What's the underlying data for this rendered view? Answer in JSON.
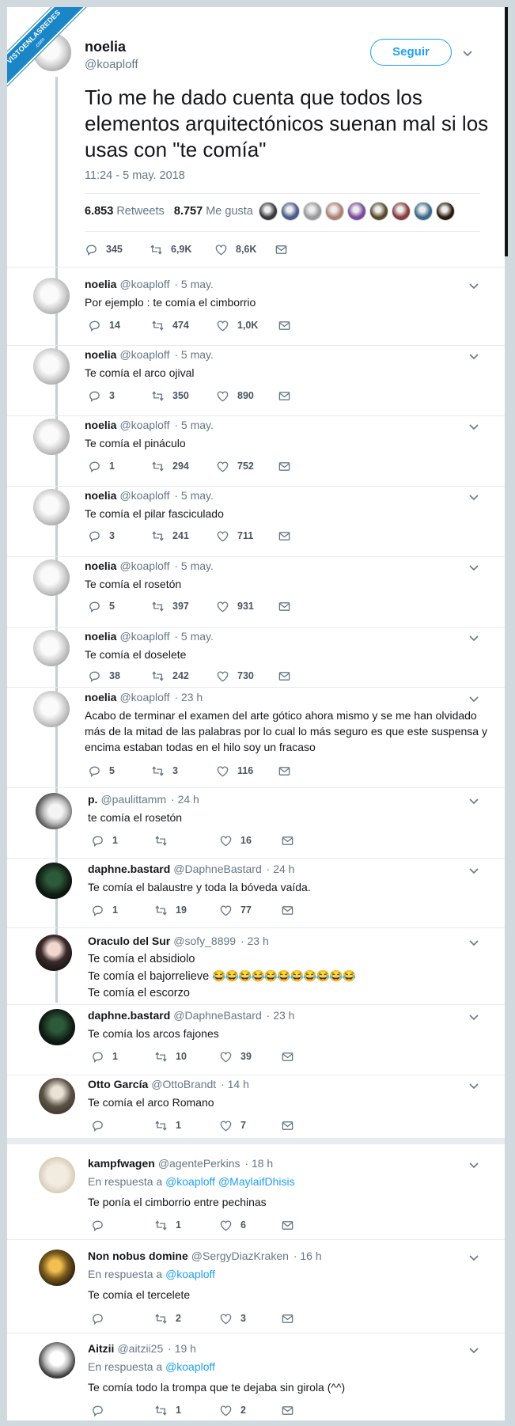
{
  "watermark": {
    "line1": "VISTOENLASREDES",
    "line2": ".com"
  },
  "main_tweet": {
    "name": "noelia",
    "handle": "@koaploff",
    "follow_label": "Seguir",
    "text": "Tio me he dado cuenta que todos los elementos arquitectónicos suenan mal si los usas con \"te comía\"",
    "timestamp": "11:24 - 5 may. 2018",
    "retweets_count": "6.853",
    "retweets_label": "Retweets",
    "likes_count": "8.757",
    "likes_label": "Me gusta",
    "replies": "345",
    "rts": "6,9K",
    "favs": "8,6K"
  },
  "likers": [
    "#3a3a3a",
    "#4a5a8a",
    "#9a9a9a",
    "#b08070",
    "#7a4a9a",
    "#5a4a2a",
    "#8a3a3a",
    "#3a6a8a",
    "#2a1a0a"
  ],
  "tweets": [
    {
      "name": "noelia",
      "handle": "@koaploff",
      "time": "· 5 may.",
      "text": "Por ejemplo : te comía el cimborrio",
      "replies": "14",
      "rts": "474",
      "favs": "1,0K"
    },
    {
      "name": "noelia",
      "handle": "@koaploff",
      "time": "· 5 may.",
      "text": "Te comía el arco ojival",
      "replies": "3",
      "rts": "350",
      "favs": "890"
    },
    {
      "name": "noelia",
      "handle": "@koaploff",
      "time": "· 5 may.",
      "text": "Te comía el pináculo",
      "replies": "1",
      "rts": "294",
      "favs": "752"
    },
    {
      "name": "noelia",
      "handle": "@koaploff",
      "time": "· 5 may.",
      "text": "Te comía el pilar fasciculado",
      "replies": "3",
      "rts": "241",
      "favs": "711"
    },
    {
      "name": "noelia",
      "handle": "@koaploff",
      "time": "· 5 may.",
      "text": "Te comía el rosetón",
      "replies": "5",
      "rts": "397",
      "favs": "931"
    },
    {
      "name": "noelia",
      "handle": "@koaploff",
      "time": "· 5 may.",
      "text": "Te comía el doselete",
      "replies": "38",
      "rts": "242",
      "favs": "730"
    },
    {
      "name": "noelia",
      "handle": "@koaploff",
      "time": "· 23 h",
      "text": "Acabo de terminar el examen del arte gótico ahora mismo y se me han olvidado más de la mitad de las palabras por lo cual lo más seguro es que este suspensa y encima estaban todas en el hilo soy un fracaso",
      "replies": "5",
      "rts": "3",
      "favs": "116"
    },
    {
      "name": "p.",
      "handle": "@paulittamm",
      "time": "· 24 h",
      "text": "te comía el rosetón",
      "replies": "1",
      "rts": "",
      "favs": "16"
    },
    {
      "name": "daphne.bastard",
      "handle": "@DaphneBastard",
      "time": "· 24 h",
      "text": "Te comía el balaustre y toda la bóveda vaída.",
      "replies": "1",
      "rts": "19",
      "favs": "77"
    },
    {
      "name": "Oraculo del Sur",
      "handle": "@sofy_8899",
      "time": "· 23 h",
      "text1": "Te comía el absidiolo",
      "text2": "Te comía el bajorrelieve",
      "emoji": "😂😂😂😂😂😂😂😂😂😂😂",
      "text3": "Te comía el escorzo"
    },
    {
      "name": "daphne.bastard",
      "handle": "@DaphneBastard",
      "time": "· 23 h",
      "text": "Te comía los arcos fajones",
      "replies": "1",
      "rts": "10",
      "favs": "39"
    },
    {
      "name": "Otto García",
      "handle": "@OttoBrandt",
      "time": "· 14 h",
      "text": "Te comía el arco Romano",
      "replies": "",
      "rts": "1",
      "favs": "7"
    }
  ],
  "replies_section": [
    {
      "name": "kampfwagen",
      "handle": "@agentePerkins",
      "time": "· 18 h",
      "reply_prefix": "En respuesta a",
      "reply_to": "@koaploff @MaylaifDhisis",
      "text": "Te ponía el cimborrio entre pechinas",
      "replies": "",
      "rts": "1",
      "favs": "6"
    },
    {
      "name": "Non nobus domine",
      "handle": "@SergyDiazKraken",
      "time": "· 16 h",
      "reply_prefix": "En respuesta a",
      "reply_to": "@koaploff",
      "text": "Te comía el tercelete",
      "replies": "",
      "rts": "2",
      "favs": "3"
    },
    {
      "name": "Aitzii",
      "handle": "@aitzii25",
      "time": "· 19 h",
      "reply_prefix": "En respuesta a",
      "reply_to": "@koaploff",
      "text": "Te comía todo la trompa que te dejaba sin girola (^^)",
      "replies": "",
      "rts": "1",
      "favs": "2"
    }
  ],
  "colors": {
    "accent": "#1da1f2",
    "muted": "#657786",
    "text": "#14171a",
    "watermark": "#1a86c8"
  },
  "icons": [
    "reply-icon",
    "retweet-icon",
    "like-icon",
    "message-icon",
    "chevron-down-icon"
  ]
}
